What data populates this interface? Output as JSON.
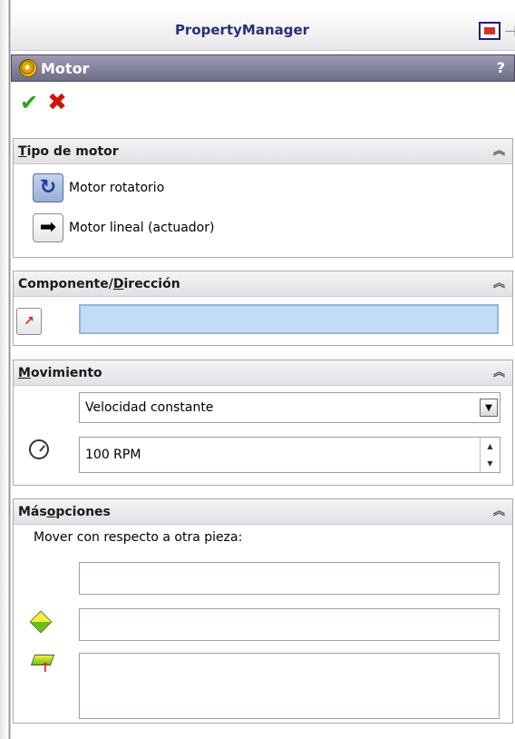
{
  "header": {
    "title": "PropertyManager"
  },
  "feature": {
    "title": "Motor",
    "help": "?"
  },
  "actions": {
    "ok": "✔",
    "cancel": "✖"
  },
  "motor_type": {
    "title_underlined": "T",
    "title_rest": "ipo de motor",
    "options": [
      {
        "label": "Motor rotatorio",
        "selected": true
      },
      {
        "label": "Motor lineal (actuador)",
        "selected": false
      }
    ]
  },
  "component": {
    "title_pre": "Componente/",
    "title_underlined": "D",
    "title_post": "irección",
    "value": ""
  },
  "movement": {
    "title_underlined": "M",
    "title_rest": "ovimiento",
    "type_selected": "Velocidad constante",
    "speed_value": "100 RPM"
  },
  "more_options": {
    "title_pre": "Más ",
    "title_underlined": "o",
    "title_post": "pciones",
    "relative_label": "Mover con respecto a otra pieza:"
  },
  "colors": {
    "feature_bar": "#7b7a95",
    "accent_title": "#2a2f7a",
    "ok_green": "#2fa01a",
    "cancel_red": "#d0150a",
    "selection_box": "#c2dcf5"
  },
  "icons": {
    "motor": "motor-gear-icon",
    "rotary": "rotary-motor-icon",
    "linear": "linear-motor-arrow-icon",
    "direction": "direction-arrow-icon",
    "speed": "speedometer-icon",
    "component": "component-cube-icon",
    "face": "face-select-icon"
  }
}
